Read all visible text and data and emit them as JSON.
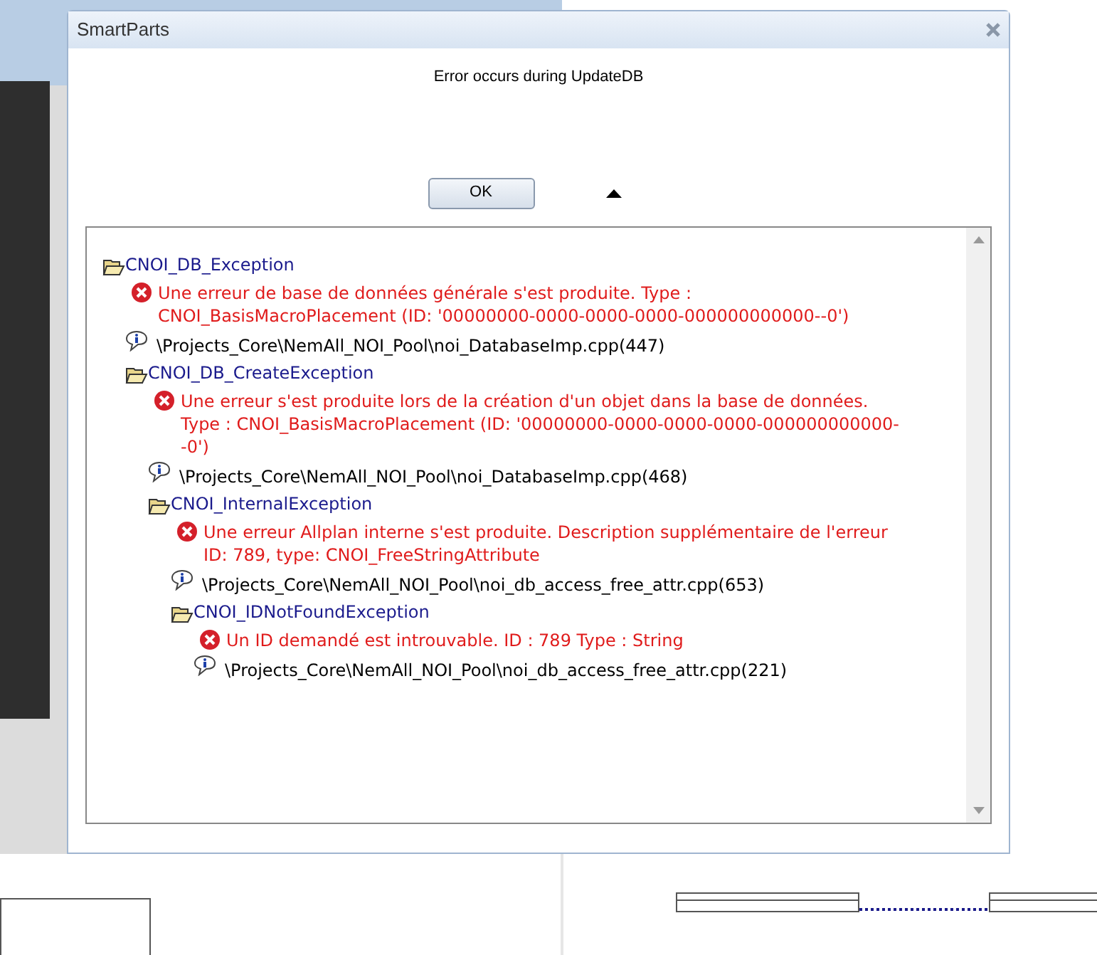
{
  "dialog": {
    "title": "SmartParts",
    "message": "Error occurs during UpdateDB",
    "ok_button": "OK"
  },
  "tree": [
    {
      "kind": "exception",
      "label": "CNOI_DB_Exception",
      "children": [
        {
          "kind": "error",
          "label": "Une erreur de base de données générale s'est produite. Type : CNOI_BasisMacroPlacement (ID: '00000000-0000-0000-0000-000000000000--0')"
        },
        {
          "kind": "info",
          "label": "\\Projects_Core\\NemAll_NOI_Pool\\noi_DatabaseImp.cpp(447)"
        },
        {
          "kind": "exception",
          "label": "CNOI_DB_CreateException",
          "children": [
            {
              "kind": "error",
              "label": "Une erreur s'est produite lors de la création d'un objet dans la base de données. Type : CNOI_BasisMacroPlacement (ID: '00000000-0000-0000-0000-000000000000--0')"
            },
            {
              "kind": "info",
              "label": "\\Projects_Core\\NemAll_NOI_Pool\\noi_DatabaseImp.cpp(468)"
            },
            {
              "kind": "exception",
              "label": "CNOI_InternalException",
              "children": [
                {
                  "kind": "error",
                  "label": "Une erreur Allplan interne s'est produite. Description supplémentaire de l'erreur ID: 789, type: CNOI_FreeStringAttribute"
                },
                {
                  "kind": "info",
                  "label": "\\Projects_Core\\NemAll_NOI_Pool\\noi_db_access_free_attr.cpp(653)"
                },
                {
                  "kind": "exception",
                  "label": "CNOI_IDNotFoundException",
                  "children": [
                    {
                      "kind": "error",
                      "label": "Un ID demandé est introuvable. ID : 789 Type : String"
                    },
                    {
                      "kind": "info",
                      "label": "\\Projects_Core\\NemAll_NOI_Pool\\noi_db_access_free_attr.cpp(221)"
                    }
                  ]
                }
              ]
            }
          ]
        }
      ]
    }
  ]
}
